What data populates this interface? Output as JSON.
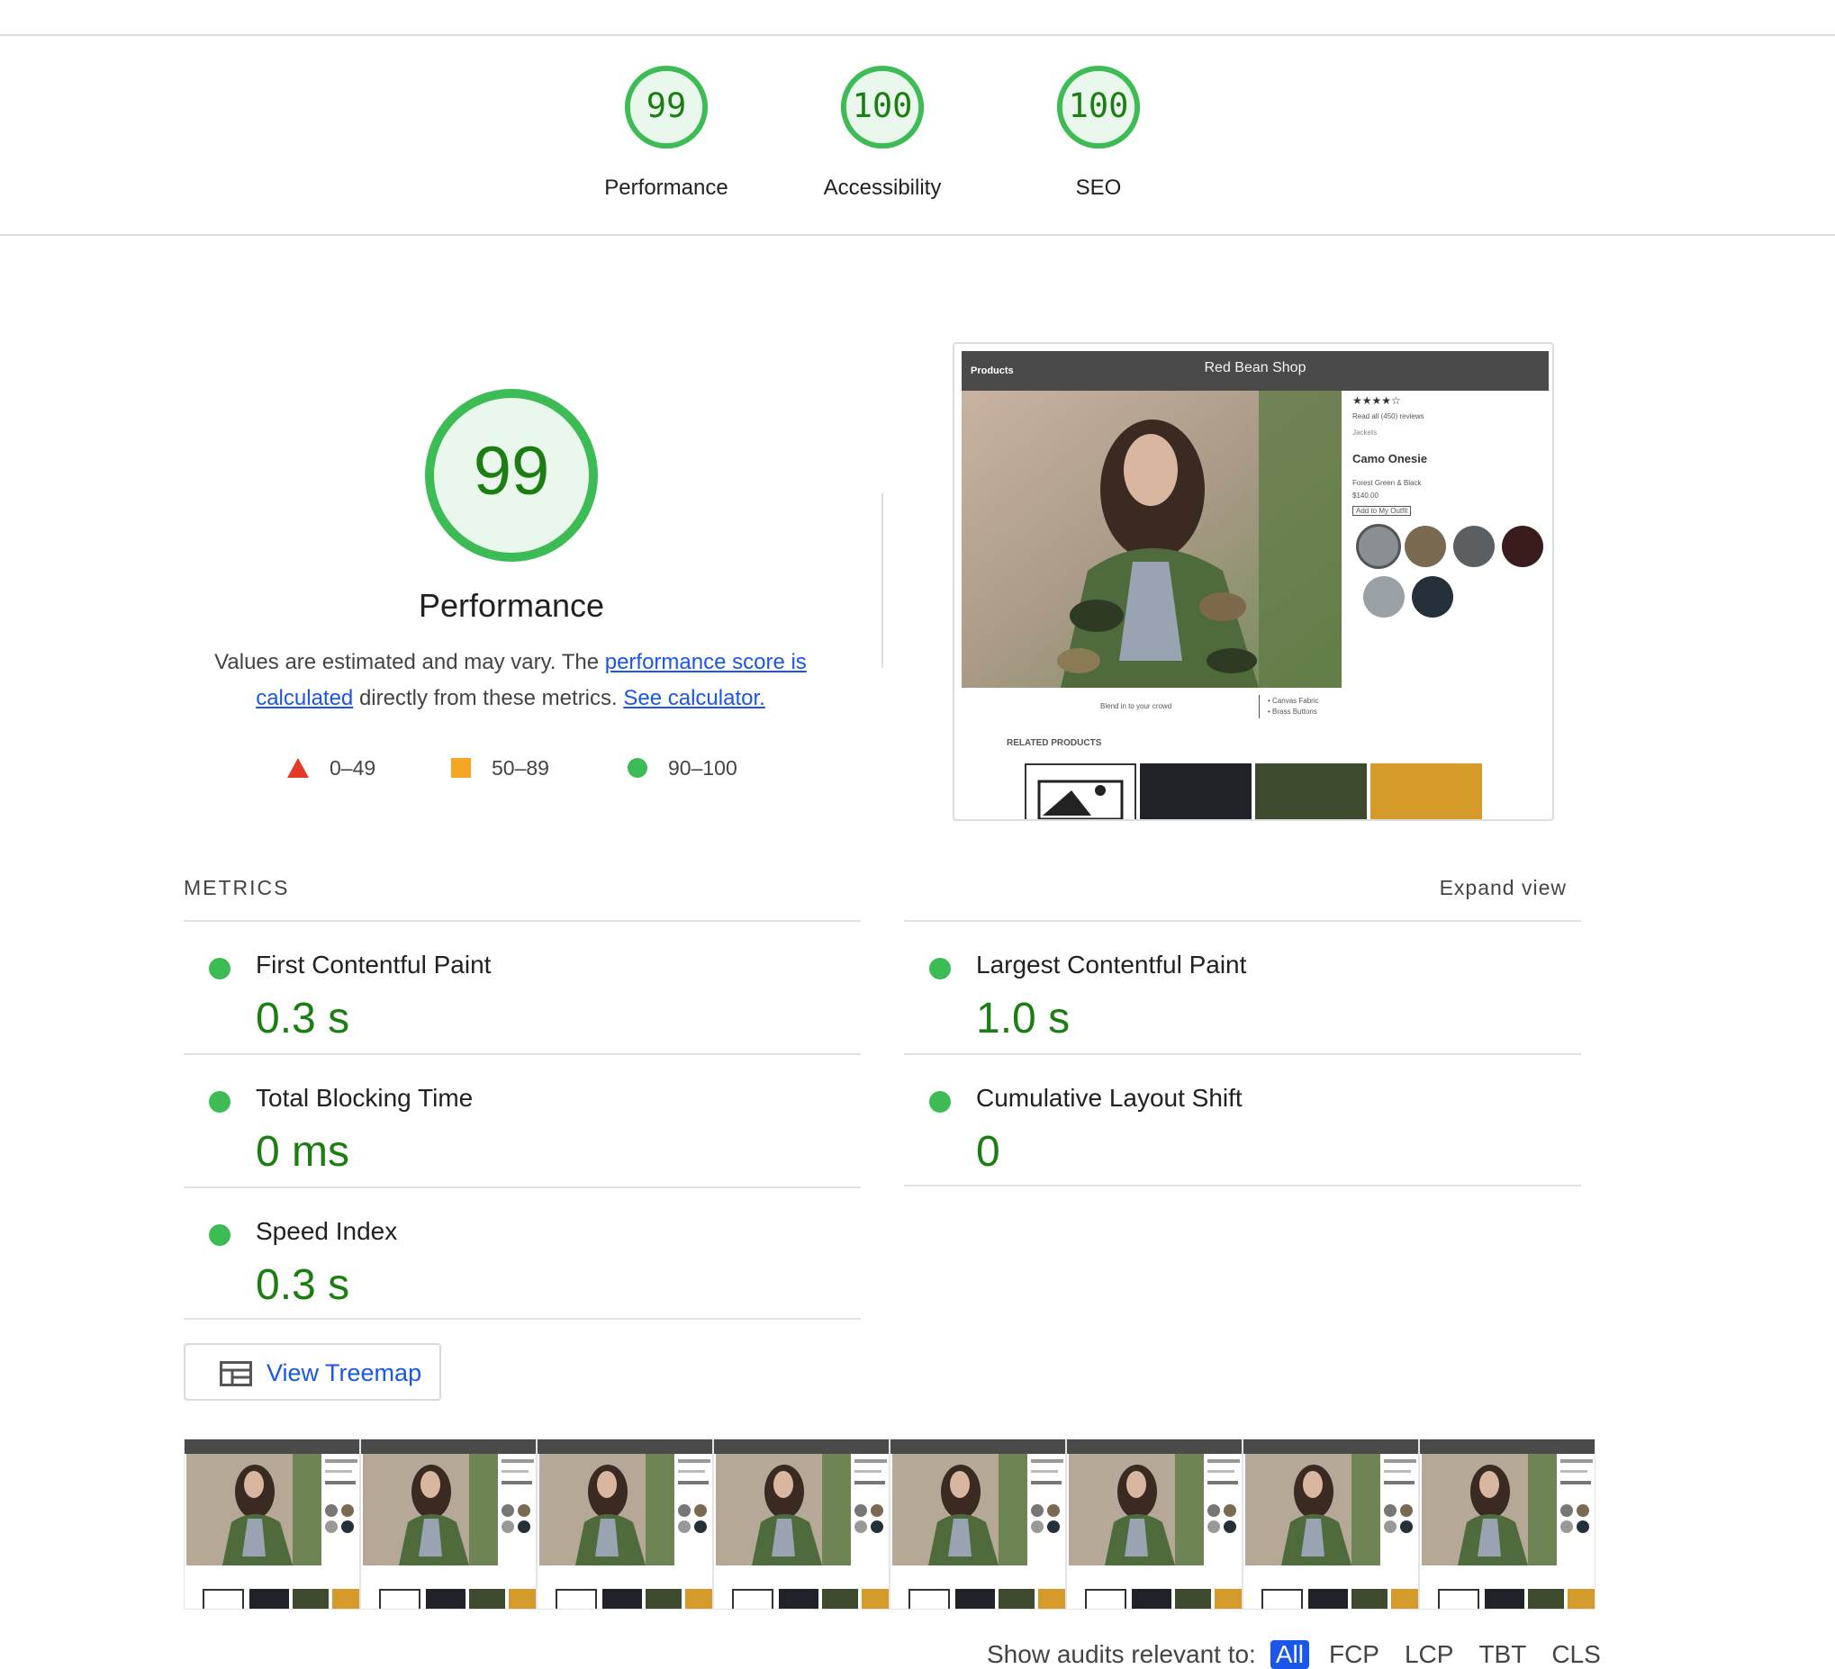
{
  "top_gauges": [
    {
      "score": "99",
      "label": "Performance"
    },
    {
      "score": "100",
      "label": "Accessibility"
    },
    {
      "score": "100",
      "label": "SEO"
    }
  ],
  "performance": {
    "score": "99",
    "title": "Performance",
    "desc_prefix": "Values are estimated and may vary. The ",
    "score_link": "performance score is calculated",
    "desc_middle": " directly from these metrics. ",
    "calc_link": "See calculator."
  },
  "legend": [
    {
      "range": "0–49"
    },
    {
      "range": "50–89"
    },
    {
      "range": "90–100"
    }
  ],
  "screenshot": {
    "nav_left": "Products",
    "shop_title": "Red Bean Shop",
    "stars": "★★★★☆",
    "reviews": "Read all (450) reviews",
    "category": "Jackets",
    "product_name": "Camo Onesie",
    "color": "Forest Green & Black",
    "price": "$140.00",
    "add_button": "Add to My Outfit",
    "tagline": "Blend in to your crowd",
    "features": [
      "• Canvas Fabric",
      "• Brass Buttons"
    ],
    "related": "RELATED PRODUCTS"
  },
  "metrics": {
    "heading": "METRICS",
    "expand": "Expand view",
    "items": [
      {
        "title": "First Contentful Paint",
        "value": "0.3 s"
      },
      {
        "title": "Largest Contentful Paint",
        "value": "1.0 s"
      },
      {
        "title": "Total Blocking Time",
        "value": "0 ms"
      },
      {
        "title": "Cumulative Layout Shift",
        "value": "0"
      },
      {
        "title": "Speed Index",
        "value": "0.3 s"
      }
    ]
  },
  "treemap": {
    "label": "View Treemap"
  },
  "audits": {
    "label": "Show audits relevant to:",
    "filters": [
      "All",
      "FCP",
      "LCP",
      "TBT",
      "CLS"
    ],
    "active": "All"
  },
  "colors": {
    "pass_green": "#1b7d12",
    "pass_ring": "#3dbb54",
    "pass_fill": "#eaf7ec",
    "average_orange": "#f5a623",
    "fail_red": "#e53a2a",
    "link_blue": "#1a56e8"
  }
}
